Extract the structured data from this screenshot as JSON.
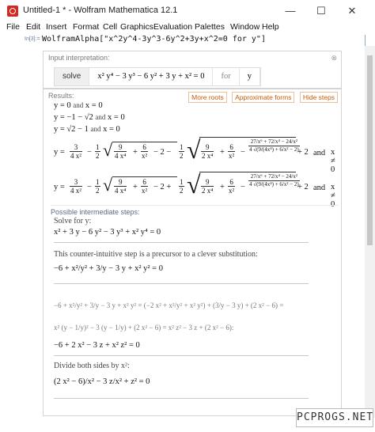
{
  "window": {
    "title": "Untitled-1 * - Wolfram Mathematica 12.1",
    "minimize": "—",
    "maximize": "☐",
    "close": "✕"
  },
  "menu": [
    "File",
    "Edit",
    "Insert",
    "Format",
    "Cell",
    "Graphics",
    "Evaluation",
    "Palettes",
    "Window",
    "Help"
  ],
  "input": {
    "label": "In[3]:=",
    "code": "WolframAlpha[\"x^2y^4-3y^3-6y^2+3y+x^2=0 for y\"]"
  },
  "interp": {
    "header": "Input interpretation:",
    "verb": "solve",
    "equation": "x² y⁴ − 3 y³ − 6 y² + 3 y + x² = 0",
    "for": "for",
    "var": "y",
    "close": "⊗"
  },
  "results": {
    "header": "Results:",
    "buttons": [
      "More roots",
      "Approximate forms",
      "Hide steps"
    ],
    "close": "⊗",
    "lines": [
      {
        "eq": "y = 0",
        "and": "and",
        "cond": "x = 0"
      },
      {
        "eq": "y = −1 − √2",
        "and": "and",
        "cond": "x = 0"
      },
      {
        "eq": "y = √2 − 1",
        "and": "and",
        "cond": "x = 0"
      }
    ],
    "long1": "y = 3/(4x²) − 1/2 √(9/(4x⁴) + 6/x² − 2) − 1/2 √(9/(2x⁴) + 6/x² − (27/x⁶ + 72/x⁴ − 24/x²)/(4√(9/(4x⁴) + 6/x² − 2)) + 2)",
    "long2": "y = 3/(4x²) − 1/2 √(9/(4x⁴) + 6/x² − 2) + 1/2 √(9/(2x⁴) + 6/x² − (27/x⁶ + 72/x⁴ − 24/x²)/(4√(9/(4x⁴) + 6/x² − 2)) + 2)",
    "long_and": "and",
    "long_cond": "x ≠ 0"
  },
  "steps": {
    "header": "Possible intermediate steps:",
    "solve_for": "Solve for y:",
    "eq1": "x² + 3 y − 6 y² − 3 y³ + x² y⁴ = 0",
    "note1": "This counter-intuitive step is a precursor to a clever substitution:",
    "eq2": "−6 + x²/y² + 3/y − 3 y + x² y² = 0",
    "eq3a": "−6 + x²/y² + 3/y − 3 y + x² y² = (−2 x² + x²/y² + x² y²) + (3/y − 3 y) + (2 x² − 6) =",
    "eq3b": "x² (y − 1/y)² − 3 (y − 1/y) + (2 x² − 6) = x² z² − 3 z + (2 x² − 6):",
    "eq3c": "−6 + 2 x² − 3 z + x² z² = 0",
    "note2": "Divide both sides by x²:",
    "eq4": "(2 x² − 6)/x² − 3 z/x² + z² = 0"
  },
  "watermark": "PCPROGS.NET"
}
